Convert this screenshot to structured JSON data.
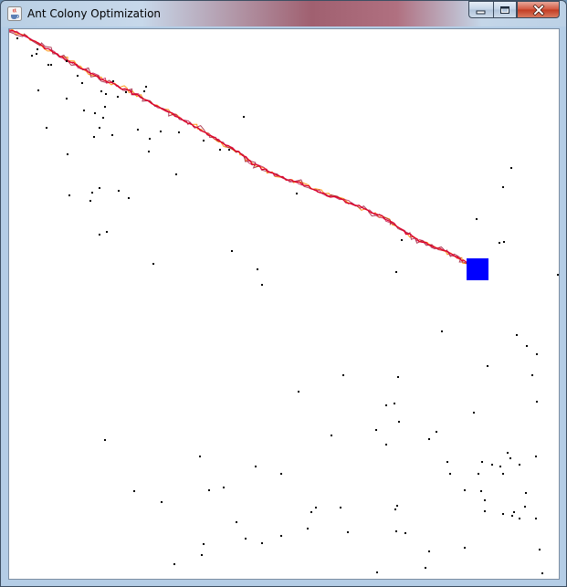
{
  "window": {
    "title": "Ant Colony Optimization",
    "icon": "java-cup-icon"
  },
  "controls": {
    "minimize_icon": "minimize-icon",
    "maximize_icon": "maximize-icon",
    "close_icon": "close-icon"
  },
  "colors": {
    "canvas_background": "#ffffff",
    "obstacle_dot": "#000000",
    "goal_square": "#0000ff",
    "trail_primary": "#e0002a",
    "trail_secondary": "#ff8c00",
    "close_button": "#c8432a"
  }
}
